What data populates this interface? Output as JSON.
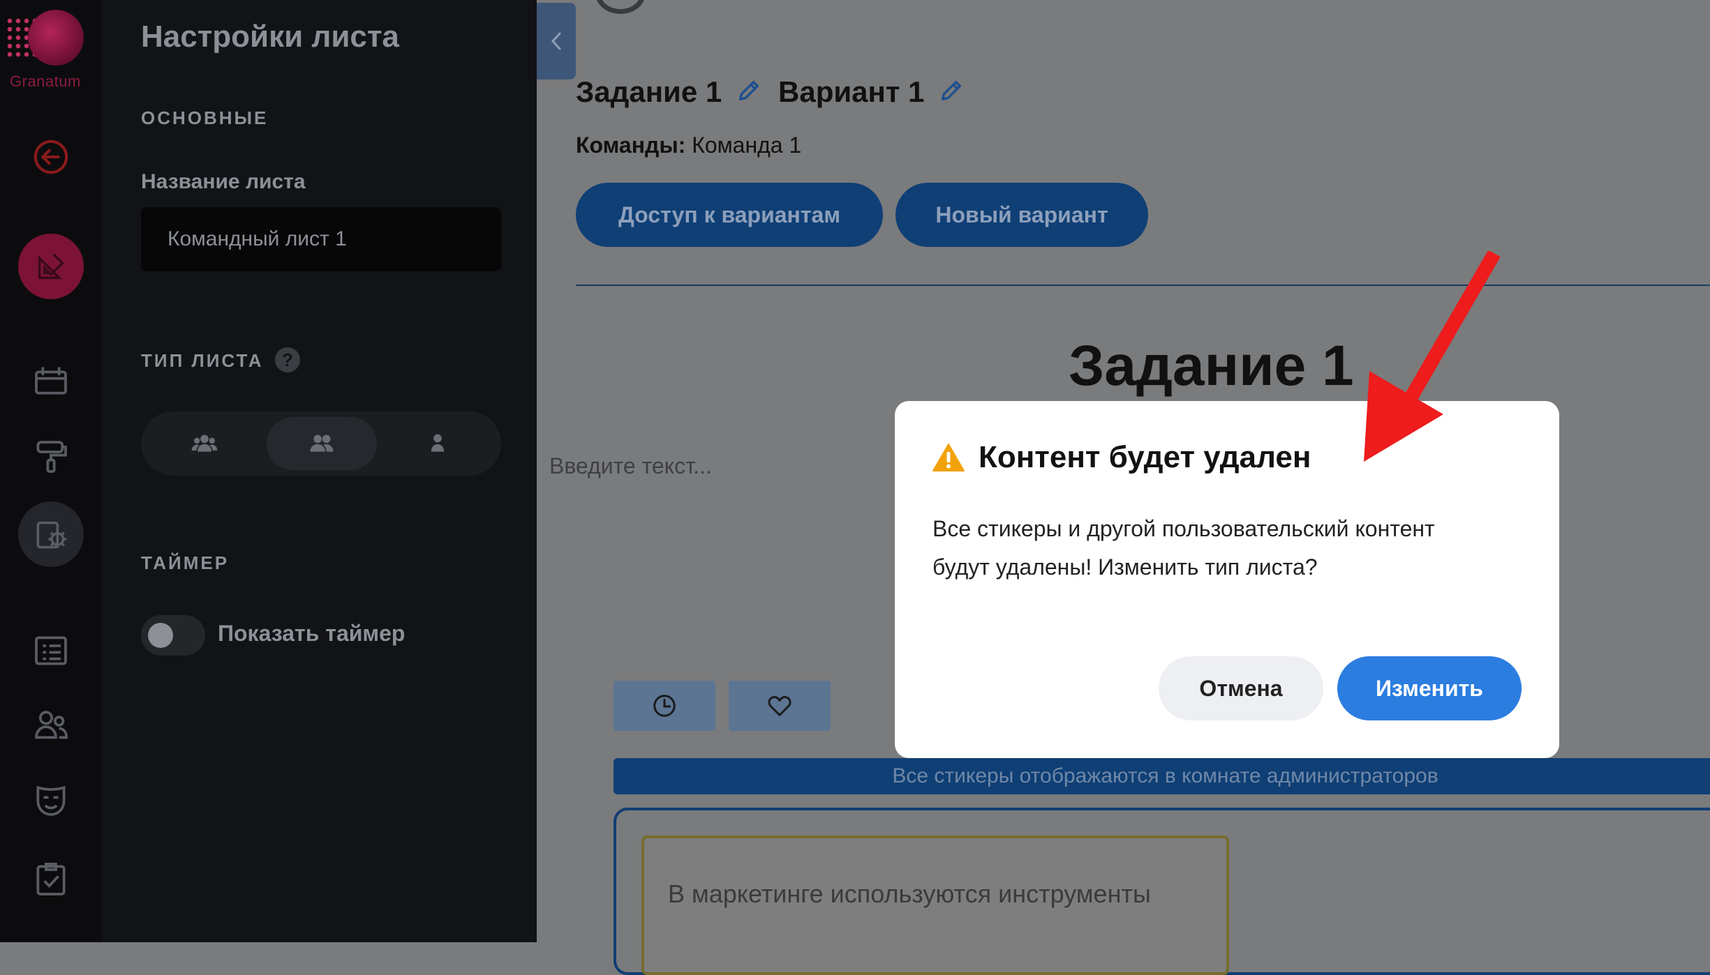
{
  "brand": {
    "name": "Granatum"
  },
  "rail": {
    "items": [
      "back-arrow-icon",
      "geometry-tools-icon",
      "calendar-icon",
      "paint-roller-icon",
      "settings-gear-icon",
      "list-icon",
      "users-icon",
      "theater-mask-icon",
      "checklist-icon"
    ]
  },
  "panel": {
    "title": "Настройки листа",
    "section_basic": "ОСНОВНЫЕ",
    "name_label": "Название листа",
    "name_value": "Командный лист 1",
    "section_type": "ТИП ЛИСТА",
    "help": "?",
    "type_options": [
      "group-icon",
      "team-icon",
      "single-user-icon"
    ],
    "type_selected_index": 1,
    "section_timer": "ТАЙМЕР",
    "timer_toggle_label": "Показать таймер",
    "timer_enabled": false
  },
  "main": {
    "task_label": "Задание 1",
    "variant_label": "Вариант 1",
    "teams_prefix": "Команды:",
    "teams_value": "Команда 1",
    "btn_access": "Доступ к вариантам",
    "btn_new_variant": "Новый вариант",
    "heading": "Задание 1",
    "text_placeholder": "Введите текст...",
    "admin_notice": "Все стикеры отображаются в комнате администраторов",
    "sticker_text": "В маркетинге используются инструменты"
  },
  "modal": {
    "title": "Контент будет удален",
    "body": "Все стикеры и другой пользовательский контент будут удалены! Изменить тип листа?",
    "cancel": "Отмена",
    "confirm": "Изменить"
  },
  "colors": {
    "accent": "#2b7de0",
    "warning": "#f2a20a",
    "annotation": "#ee1c1c",
    "brand": "#7c1336"
  }
}
